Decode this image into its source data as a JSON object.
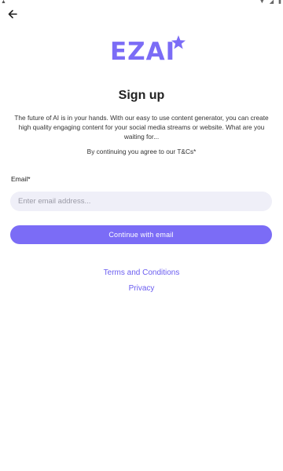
{
  "status_bar": {
    "left_glyph": "▲",
    "icons": [
      "wifi-icon",
      "signal-icon",
      "battery-icon"
    ]
  },
  "header": {
    "back_icon": "arrow-left-icon"
  },
  "logo": {
    "text": "EZAI",
    "color": "#7b6cf6"
  },
  "page": {
    "title": "Sign up",
    "intro": "The future of AI is in your hands. With our easy to use content generator, you can create high quality engaging content for your social media streams or website. What are you waiting for...",
    "agree": "By continuing you agree to our T&Cs*"
  },
  "form": {
    "email_label": "Email*",
    "email_placeholder": "Enter email address...",
    "email_value": "",
    "continue_label": "Continue with email"
  },
  "links": {
    "terms": "Terms and Conditions",
    "privacy": "Privacy"
  },
  "colors": {
    "accent": "#7b6cf6",
    "input_bg": "#efeff8",
    "link": "#6a5cf0"
  }
}
